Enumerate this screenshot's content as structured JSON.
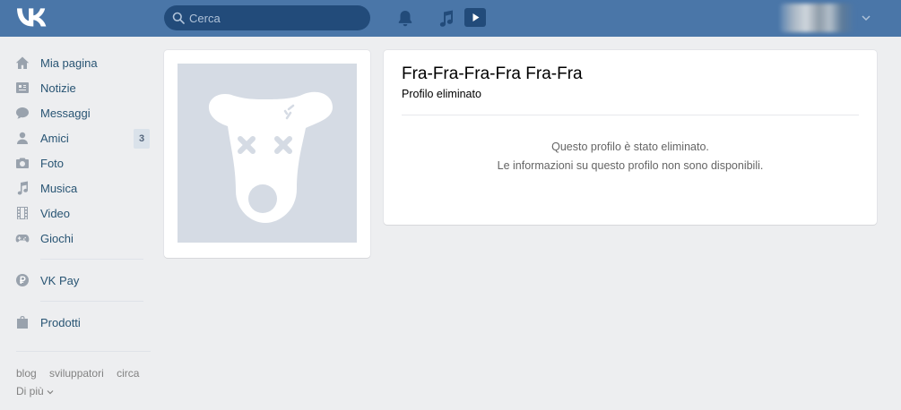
{
  "header": {
    "search": {
      "placeholder": "Cerca"
    }
  },
  "sidebar": {
    "items": [
      {
        "label": "Mia pagina",
        "icon": "home-icon"
      },
      {
        "label": "Notizie",
        "icon": "news-icon"
      },
      {
        "label": "Messaggi",
        "icon": "messages-icon"
      },
      {
        "label": "Amici",
        "icon": "friends-icon",
        "badge": "3"
      },
      {
        "label": "Foto",
        "icon": "camera-icon"
      },
      {
        "label": "Musica",
        "icon": "music-icon"
      },
      {
        "label": "Video",
        "icon": "film-icon"
      },
      {
        "label": "Giochi",
        "icon": "gamepad-icon"
      },
      {
        "label": "VK Pay",
        "icon": "ruble-icon"
      },
      {
        "label": "Prodotti",
        "icon": "bag-icon"
      }
    ],
    "footer": {
      "blog": "blog",
      "developers": "sviluppatori",
      "about": "circa",
      "more": "Di più"
    }
  },
  "profile": {
    "name": "Fra-Fra-Fra-Fra Fra-Fra",
    "status": "Profilo eliminato",
    "message_line1": "Questo profilo è stato eliminato.",
    "message_line2": "Le informazioni su questo profilo non sono disponibili."
  },
  "colors": {
    "header_bg": "#4a76a8",
    "page_bg": "#edeef0",
    "link": "#285473",
    "icon": "#99a2ad",
    "placeholder_bg": "#d5dbe4"
  }
}
